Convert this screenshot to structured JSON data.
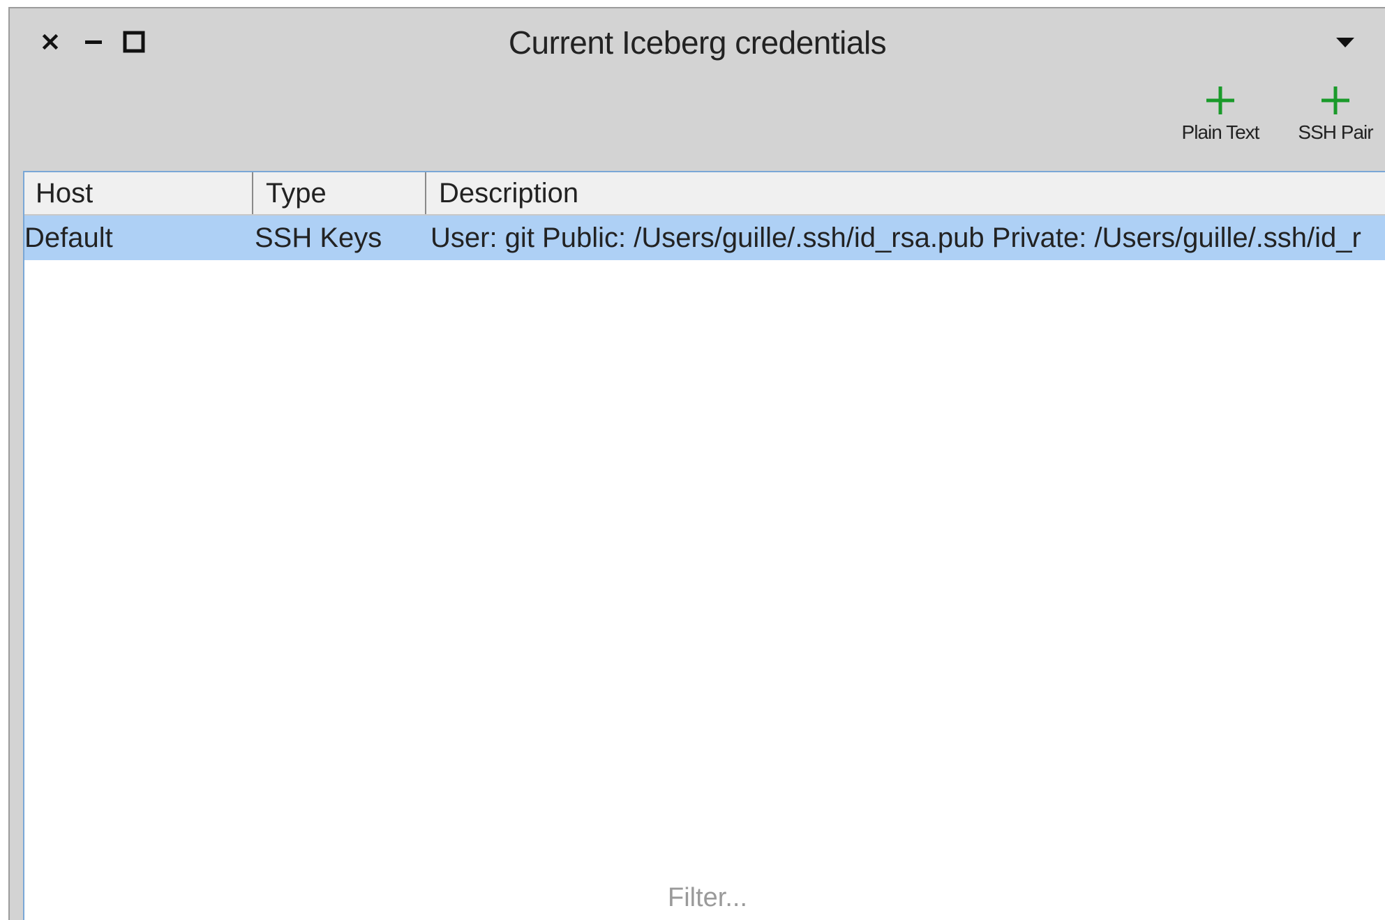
{
  "window": {
    "title": "Current Iceberg credentials"
  },
  "titlebar": {
    "close_icon": "close-icon",
    "minimize_icon": "minimize-icon",
    "maximize_icon": "maximize-icon",
    "menu_icon": "chevron-down-icon"
  },
  "toolbar": {
    "buttons": [
      {
        "label": "Plain Text",
        "icon": "plus-icon"
      },
      {
        "label": "SSH Pair",
        "icon": "plus-icon"
      }
    ],
    "icon_color": "#1a9a2a"
  },
  "table": {
    "columns": [
      "Host",
      "Type",
      "Description"
    ],
    "rows": [
      {
        "host": "Default",
        "type": "SSH Keys",
        "description": "User: git Public: /Users/guille/.ssh/id_rsa.pub Private: /Users/guille/.ssh/id_r"
      }
    ],
    "selected_row_color": "#aed0f5",
    "filter_placeholder": "Filter..."
  }
}
